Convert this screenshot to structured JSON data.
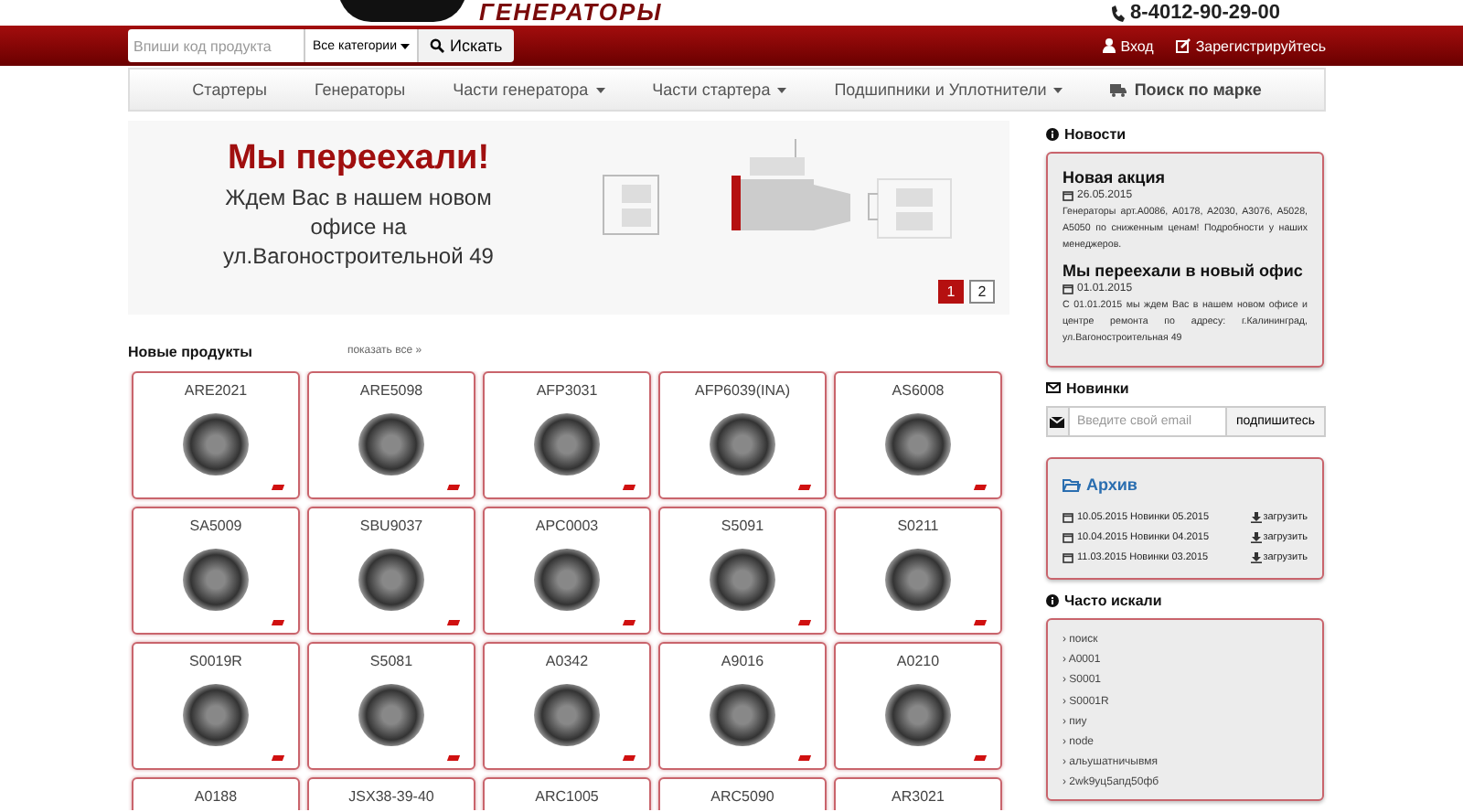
{
  "header": {
    "logo_text": "ГЕНЕРАТОРЫ",
    "phone": "8-4012-90-29-00"
  },
  "topbar": {
    "search": {
      "placeholder": "Впиши код продукта"
    },
    "category": "Все категории",
    "search_button": "Искать",
    "login": "Вход",
    "register": "Зарегистрируйтесь"
  },
  "nav": [
    {
      "label": "Стартеры",
      "kind": "link",
      "dropdown": false
    },
    {
      "label": "Генераторы",
      "kind": "link",
      "dropdown": false
    },
    {
      "label": "Части генератора",
      "kind": "link",
      "dropdown": true
    },
    {
      "label": "Части стартера",
      "kind": "link",
      "dropdown": true
    },
    {
      "label": "Подшипники и Уплотнители",
      "kind": "link",
      "dropdown": true
    },
    {
      "label": "Поиск по марке",
      "kind": "brand",
      "dropdown": false
    }
  ],
  "banner": {
    "title": "Мы переехали!",
    "text": "Ждем Вас в нашем новом офисе на ул.Вагоностроительной 49",
    "pages": [
      {
        "label": "1",
        "selected": true
      },
      {
        "label": "2",
        "selected": false
      }
    ]
  },
  "products": {
    "title": "Новые продукты",
    "show_all": "показать все »",
    "items": [
      {
        "code": "ARE2021"
      },
      {
        "code": "ARE5098"
      },
      {
        "code": "AFP3031"
      },
      {
        "code": "AFP6039(INA)"
      },
      {
        "code": "AS6008"
      },
      {
        "code": "SA5009"
      },
      {
        "code": "SBU9037"
      },
      {
        "code": "APC0003"
      },
      {
        "code": "S5091"
      },
      {
        "code": "S0211"
      },
      {
        "code": "S0019R"
      },
      {
        "code": "S5081"
      },
      {
        "code": "A0342"
      },
      {
        "code": "A9016"
      },
      {
        "code": "A0210"
      },
      {
        "code": "A0188"
      },
      {
        "code": "JSX38-39-40"
      },
      {
        "code": "ARC1005"
      },
      {
        "code": "ARC5090"
      },
      {
        "code": "AR3021"
      }
    ]
  },
  "sidebar": {
    "news": {
      "title": "Новости",
      "items": [
        {
          "title": "Новая акция",
          "date": "26.05.2015",
          "text": "Генераторы арт.A0086, A0178, A2030, A3076, A5028, A5050 по сниженным ценам! Подробности у наших менеджеров."
        },
        {
          "title": "Мы переехали в новый офис",
          "date": "01.01.2015",
          "text": "С 01.01.2015 мы ждем Вас в нашем новом офисе и центре ремонта по адресу: г.Калининград, ул.Вагоностроительная 49"
        }
      ]
    },
    "newsletter": {
      "title": "Новинки",
      "placeholder": "Введите свой email",
      "button": "подпишитесь"
    },
    "archive": {
      "title": "Архив",
      "items": [
        {
          "text": "10.05.2015 Новинки 05.2015",
          "link": "загрузить"
        },
        {
          "text": "10.04.2015 Новинки 04.2015",
          "link": "загрузить"
        },
        {
          "text": "11.03.2015 Новинки 03.2015",
          "link": "загрузить"
        }
      ]
    },
    "popular": {
      "title": "Часто искали",
      "items": [
        "› поиск",
        "› A0001",
        "› S0001",
        "› S0001R",
        "› пиу",
        "› node",
        "› альушатничывмя",
        "› 2wk9yц5апд50фб"
      ]
    }
  }
}
